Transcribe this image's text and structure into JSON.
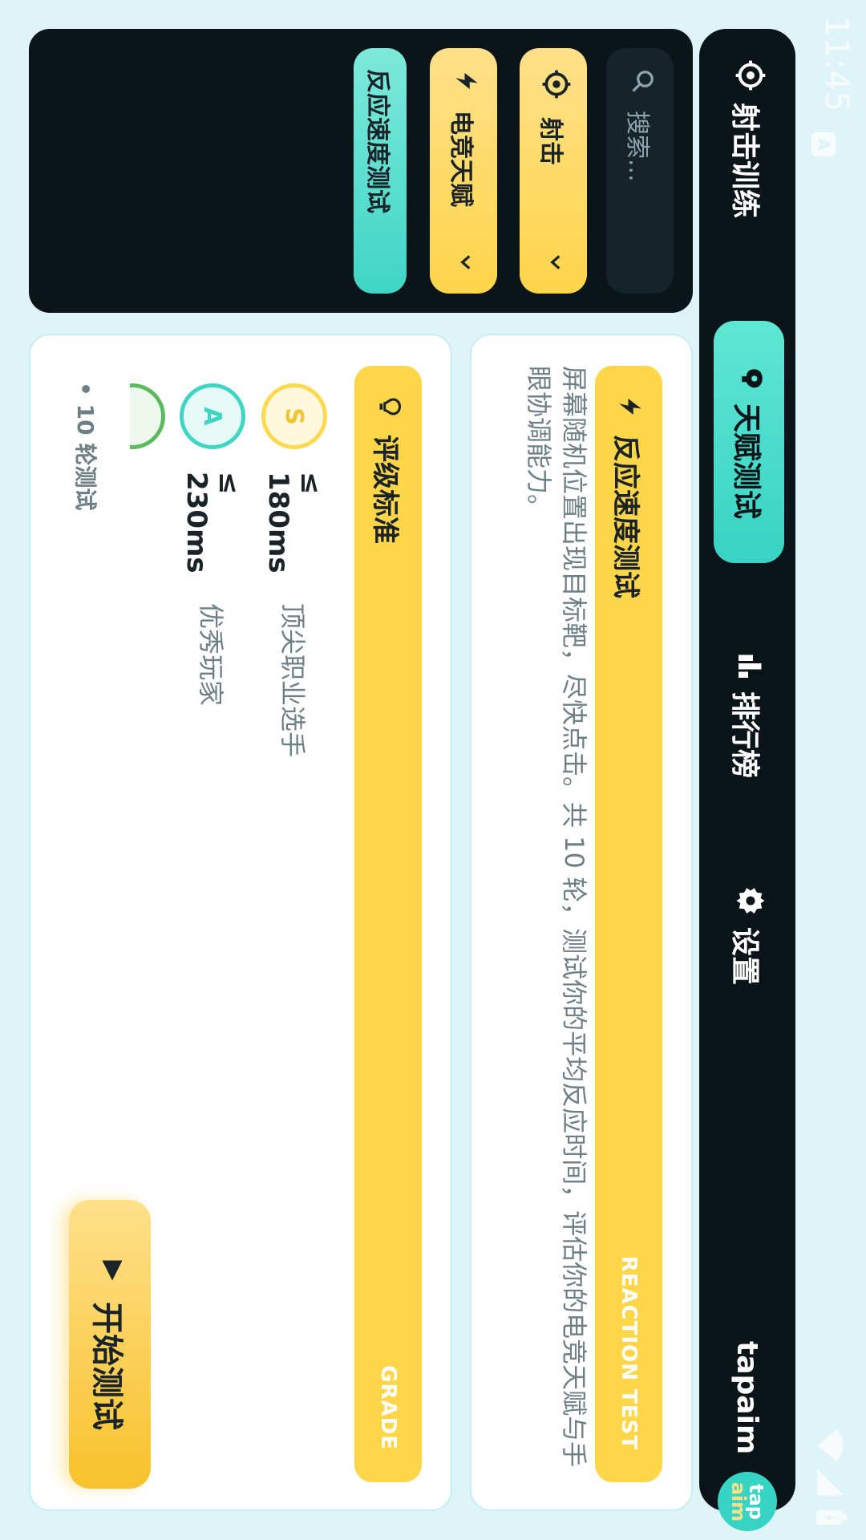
{
  "status": {
    "time": "11:45",
    "a_icon": "A"
  },
  "nav": {
    "shooting_training": "射击训练",
    "talent_test": "天赋测试",
    "leaderboard": "排行榜",
    "settings": "设置",
    "brand": "tapaim",
    "logo_line1": "tap",
    "logo_line2": "aim"
  },
  "sidebar": {
    "search_placeholder": "搜索...",
    "items": [
      {
        "label": "射击",
        "icon": "crosshair-icon",
        "chevron": "chevron-down-icon"
      },
      {
        "label": "电竞天赋",
        "icon": "lightning-icon",
        "chevron": "chevron-down-icon"
      },
      {
        "label": "反应速度测试"
      }
    ]
  },
  "info_card": {
    "title": "反应速度测试",
    "tag": "REACTION TEST",
    "description": "屏幕随机位置出现目标靶，尽快点击。共 10 轮，测试你的平均反应时间，评估你的电竞天赋与手眼协调能力。"
  },
  "grade_card": {
    "title": "评级标准",
    "tag": "GRADE",
    "grades": [
      {
        "badge": "S",
        "threshold": "≤ 180ms",
        "level": "顶尖职业选手"
      },
      {
        "badge": "A",
        "threshold": "≤ 230ms",
        "level": "优秀玩家"
      }
    ],
    "note": "• 10 轮测试"
  },
  "start_button": {
    "label": "开始测试"
  },
  "colors": {
    "accent_yellow": "#ffd54a",
    "accent_teal": "#3fd5c5",
    "dark": "#0b1418",
    "background": "#dff4f8"
  }
}
